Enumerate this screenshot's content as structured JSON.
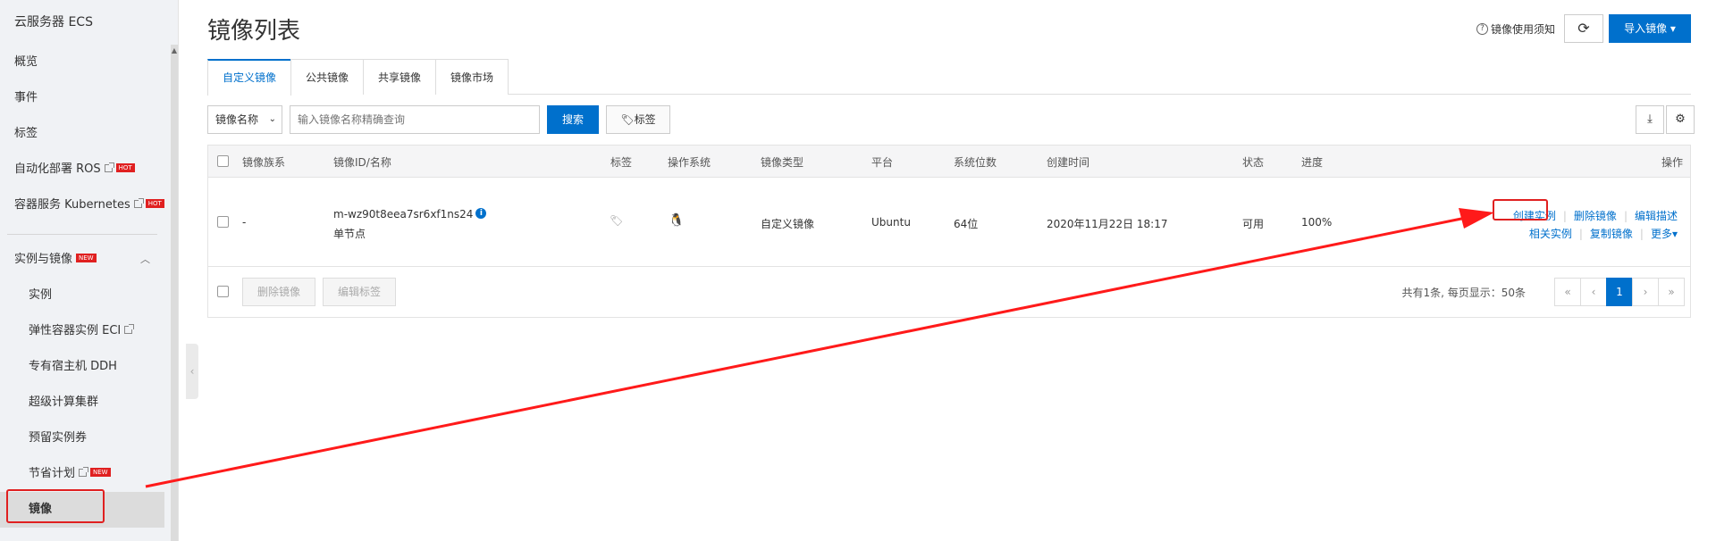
{
  "sidebar": {
    "title": "云服务器 ECS",
    "items": [
      {
        "label": "概览"
      },
      {
        "label": "事件"
      },
      {
        "label": "标签"
      },
      {
        "label": "自动化部署 ROS",
        "badge": "HOT"
      },
      {
        "label": "容器服务 Kubernetes",
        "badge": "HOT"
      }
    ],
    "group": {
      "label": "实例与镜像",
      "badge": "NEW"
    },
    "sub_items": [
      {
        "label": "实例"
      },
      {
        "label": "弹性容器实例 ECI"
      },
      {
        "label": "专有宿主机 DDH"
      },
      {
        "label": "超级计算集群"
      },
      {
        "label": "预留实例券"
      },
      {
        "label": "节省计划",
        "badge": "NEW"
      },
      {
        "label": "镜像"
      }
    ]
  },
  "header": {
    "title": "镜像列表",
    "help_label": "镜像使用须知",
    "import_label": "导入镜像 ▾"
  },
  "tabs": [
    {
      "label": "自定义镜像"
    },
    {
      "label": "公共镜像"
    },
    {
      "label": "共享镜像"
    },
    {
      "label": "镜像市场"
    }
  ],
  "toolbar": {
    "select_value": "镜像名称",
    "search_placeholder": "输入镜像名称精确查询",
    "search_label": "搜索",
    "tag_label": "标签"
  },
  "table": {
    "headers": [
      "镜像族系",
      "镜像ID/名称",
      "标签",
      "操作系统",
      "镜像类型",
      "平台",
      "系统位数",
      "创建时间",
      "状态",
      "进度",
      "操作"
    ],
    "rows": [
      {
        "family": "-",
        "id": "m-wz90t8eea7sr6xf1ns24",
        "name": "单节点",
        "image_type": "自定义镜像",
        "platform": "Ubuntu",
        "bits": "64位",
        "created": "2020年11月22日 18:17",
        "status": "可用",
        "progress": "100%",
        "actions": {
          "create": "创建实例",
          "delete": "删除镜像",
          "edit": "编辑描述",
          "related": "相关实例",
          "copy": "复制镜像",
          "more": "更多"
        }
      }
    ],
    "footer": {
      "delete_label": "删除镜像",
      "edit_tag_label": "编辑标签",
      "summary": "共有1条, 每页显示：50条",
      "page": "1"
    }
  },
  "colors": {
    "accent": "#0070cc",
    "highlight": "#e02020"
  }
}
